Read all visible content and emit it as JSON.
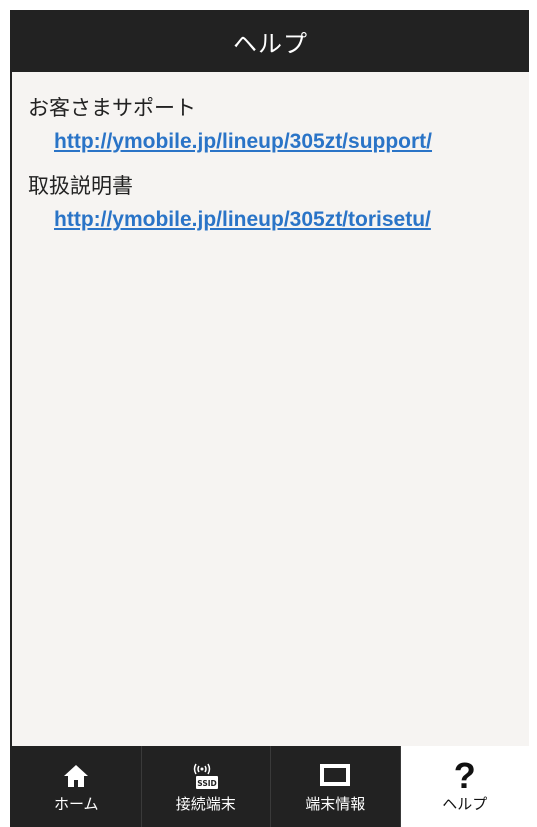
{
  "header": {
    "title": "ヘルプ"
  },
  "sections": [
    {
      "title": "お客さまサポート",
      "link": "http://ymobile.jp/lineup/305zt/support/"
    },
    {
      "title": "取扱説明書",
      "link": "http://ymobile.jp/lineup/305zt/torisetu/"
    }
  ],
  "tabs": [
    {
      "label": "ホーム",
      "icon": "home-icon"
    },
    {
      "label": "接続端末",
      "icon": "ssid-icon",
      "icon_text": "SSID"
    },
    {
      "label": "端末情報",
      "icon": "device-icon"
    },
    {
      "label": "ヘルプ",
      "icon": "help-icon",
      "icon_text": "?",
      "active": true
    }
  ],
  "colors": {
    "header_bg": "#222222",
    "link": "#2a74c7",
    "content_bg": "#f6f4f2",
    "active_tab_bg": "#ffffff"
  }
}
